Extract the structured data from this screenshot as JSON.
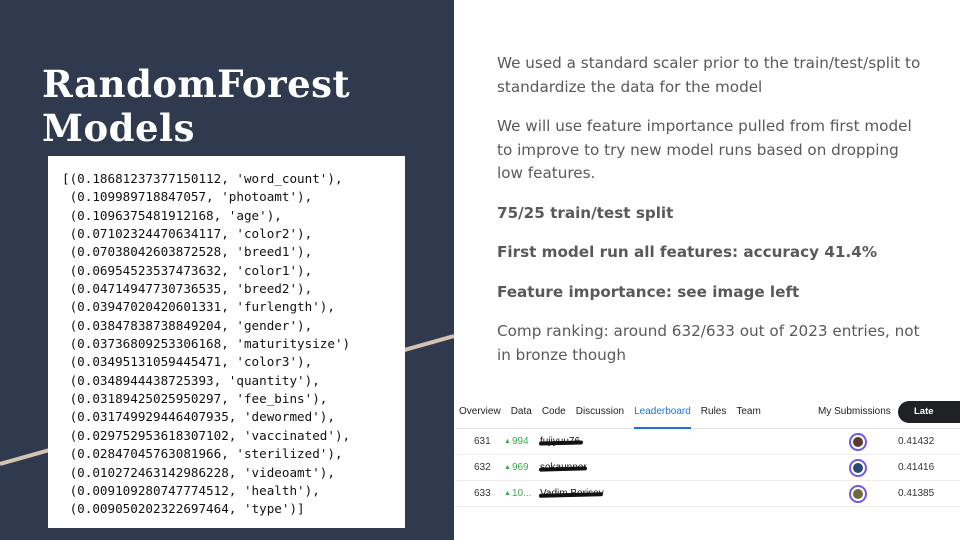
{
  "title_lines": [
    "RandomForest",
    "Models"
  ],
  "feature_importance_lines": [
    "[(0.18681237377150112, 'word_count'),",
    " (0.109989718847057, 'photoamt'),",
    " (0.1096375481912168, 'age'),",
    " (0.07102324470634117, 'color2'),",
    " (0.07038042603872528, 'breed1'),",
    " (0.06954523537473632, 'color1'),",
    " (0.04714947730736535, 'breed2'),",
    " (0.03947020420601331, 'furlength'),",
    " (0.03847838738849204, 'gender'),",
    " (0.03736809253306168, 'maturitysize')",
    " (0.03495131059445471, 'color3'),",
    " (0.0348944438725393, 'quantity'),",
    " (0.03189425025950297, 'fee_bins'),",
    " (0.031749929446407935, 'dewormed'),",
    " (0.029752953618307102, 'vaccinated'),",
    " (0.02847045763081966, 'sterilized'),",
    " (0.010272463142986228, 'videoamt'),",
    " (0.009109280747774512, 'health'),",
    " (0.009050202322697464, 'type')]"
  ],
  "paragraphs": {
    "p1": "We used a standard scaler prior to the train/test/split to standardize the data for the model",
    "p2": "We will use feature importance pulled from first model to improve to try new model runs based on dropping low features.",
    "p3": "75/25 train/test split",
    "p4": "First model run all features: accuracy 41.4%",
    "p5": "Feature importance: see image left",
    "p6": "Comp ranking: around 632/633 out of 2023 entries, not in bronze though"
  },
  "leaderboard": {
    "tabs": [
      "Overview",
      "Data",
      "Code",
      "Discussion",
      "Leaderboard",
      "Rules",
      "Team"
    ],
    "active_tab": "Leaderboard",
    "my_submissions": "My Submissions",
    "late_submission": "Late Submission",
    "rows": [
      {
        "rank": "631",
        "change": "994",
        "team": "fujiyuu76",
        "score": "0.41432"
      },
      {
        "rank": "632",
        "change": "969",
        "team": "sokaunner",
        "score": "0.41416"
      },
      {
        "rank": "633",
        "change": "10...",
        "team": "Vadim Borisov",
        "score": "0.41385"
      }
    ]
  },
  "colors": {
    "panel": "#2f3a4f",
    "accent_line": "#d5c3b1",
    "body_text": "#595959",
    "link_blue": "#1a73e8",
    "rank_up_green": "#3cab4c"
  }
}
